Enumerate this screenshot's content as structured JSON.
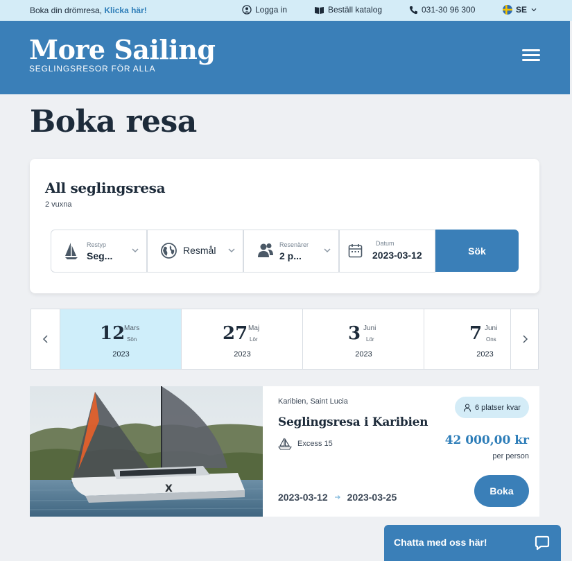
{
  "topbar": {
    "promo_text": "Boka din drömresa, ",
    "promo_link": "Klicka här!",
    "login": "Logga in",
    "catalog": "Beställ katalog",
    "phone": "031-30 96 300",
    "language": "SE"
  },
  "header": {
    "logo_title": "More Sailing",
    "logo_tagline": "SEGLINGSRESOR FÖR ALLA"
  },
  "page_title": "Boka resa",
  "search": {
    "title": "All seglingsresa",
    "subtitle": "2 vuxna",
    "type_label": "Restyp",
    "type_value": "Seg...",
    "destination_value": "Resmål",
    "travelers_label": "Resenärer",
    "travelers_value": "2 p...",
    "date_label": "Datum",
    "date_value": "2023-03-12",
    "submit": "Sök"
  },
  "dates": [
    {
      "day": "12",
      "month": "Mars",
      "weekday": "Sön",
      "year": "2023",
      "selected": true
    },
    {
      "day": "27",
      "month": "Maj",
      "weekday": "Lör",
      "year": "2023",
      "selected": false
    },
    {
      "day": "3",
      "month": "Juni",
      "weekday": "Lör",
      "year": "2023",
      "selected": false
    },
    {
      "day": "7",
      "month": "Juni",
      "weekday": "Ons",
      "year": "2023",
      "selected": false
    }
  ],
  "trip": {
    "location": "Karibien, Saint Lucia",
    "title": "Seglingsresa i Karibien",
    "boat": "Excess 15",
    "availability": "6 platser kvar",
    "price": "42 000,00 kr",
    "price_unit": "per person",
    "start_date": "2023-03-12",
    "end_date": "2023-03-25",
    "book": "Boka"
  },
  "chat": {
    "label": "Chatta med oss här!"
  },
  "colors": {
    "brand_blue": "#3a7fb8",
    "light_blue": "#d4ecf7",
    "selected_date": "#cfeefa",
    "text_dark": "#1d2b3a"
  }
}
